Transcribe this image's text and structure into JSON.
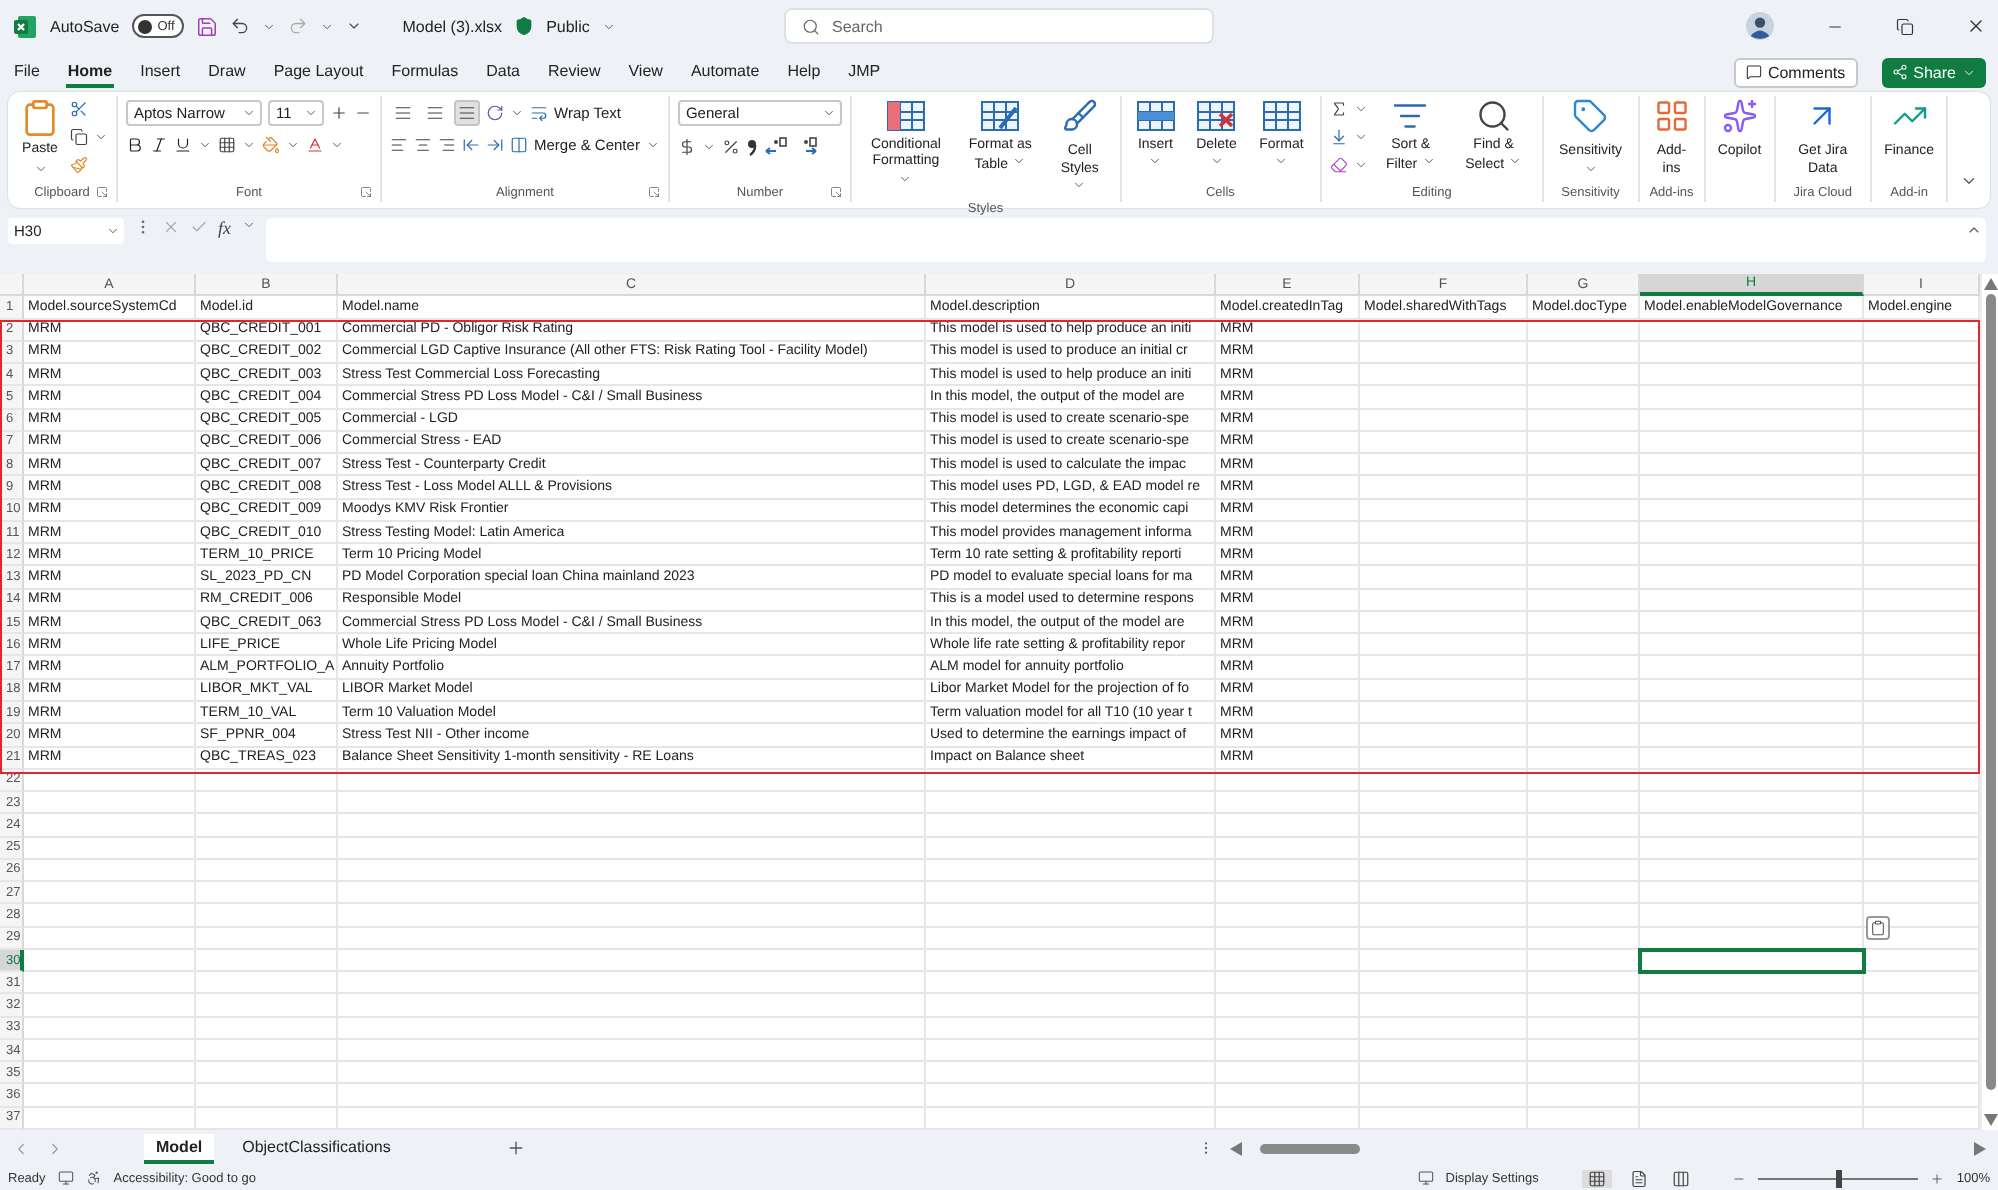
{
  "title_bar": {
    "autosave_label": "AutoSave",
    "autosave": {
      "on": false,
      "label": "Off"
    },
    "file_name": "Model (3).xlsx",
    "sensitivity": "Public",
    "search_placeholder": "Search"
  },
  "menu_tabs": [
    {
      "label": "File",
      "selected": false
    },
    {
      "label": "Home",
      "selected": true
    },
    {
      "label": "Insert",
      "selected": false
    },
    {
      "label": "Draw",
      "selected": false
    },
    {
      "label": "Page Layout",
      "selected": false
    },
    {
      "label": "Formulas",
      "selected": false
    },
    {
      "label": "Data",
      "selected": false
    },
    {
      "label": "Review",
      "selected": false
    },
    {
      "label": "View",
      "selected": false
    },
    {
      "label": "Automate",
      "selected": false
    },
    {
      "label": "Help",
      "selected": false
    },
    {
      "label": "JMP",
      "selected": false
    }
  ],
  "comments": "Comments",
  "share": "Share",
  "ribbon": {
    "groups": [
      {
        "kind": "clipboard",
        "label": "Clipboard",
        "paste": "Paste"
      },
      {
        "kind": "font",
        "label": "Font",
        "font_name": "Aptos Narrow",
        "font_size": "11"
      },
      {
        "kind": "alignment",
        "label": "Alignment",
        "wrap": "Wrap Text",
        "merge": "Merge & Center",
        "vertical_align": [
          {
            "selected": false
          },
          {
            "selected": false
          },
          {
            "selected": true
          }
        ]
      },
      {
        "kind": "number",
        "label": "Number",
        "format": "General"
      },
      {
        "kind": "buttons",
        "label": "Styles",
        "buttons": [
          {
            "label": "Conditional Formatting",
            "dropdown": true
          },
          {
            "label": "Format as Table",
            "dropdown": true
          },
          {
            "label": "Cell Styles",
            "dropdown": true
          }
        ]
      },
      {
        "kind": "buttons",
        "label": "Cells",
        "buttons": [
          {
            "label": "Insert",
            "dropdown": true
          },
          {
            "label": "Delete",
            "dropdown": true
          },
          {
            "label": "Format",
            "dropdown": true
          }
        ]
      },
      {
        "kind": "editing",
        "label": "Editing",
        "buttons": [
          {
            "label": "Sort & Filter",
            "dropdown": true
          },
          {
            "label": "Find & Select",
            "dropdown": true
          }
        ]
      },
      {
        "kind": "buttons",
        "label": "Sensitivity",
        "buttons": [
          {
            "label": "Sensitivity",
            "dropdown": true
          }
        ]
      },
      {
        "kind": "buttons",
        "label": "Add-ins",
        "buttons": [
          {
            "label": "Add-ins",
            "dropdown": false
          }
        ]
      },
      {
        "kind": "buttons",
        "buttons": [
          {
            "label": "Copilot",
            "dropdown": false
          }
        ]
      },
      {
        "kind": "buttons",
        "label": "Jira Cloud",
        "buttons": [
          {
            "label": "Get Jira Data",
            "dropdown": false
          }
        ]
      },
      {
        "kind": "buttons",
        "label": "Add-in",
        "buttons": [
          {
            "label": "Finance",
            "dropdown": false
          }
        ]
      }
    ]
  },
  "formula_bar": {
    "name_box": "H30",
    "function_label": "fx"
  },
  "columns": [
    {
      "letter": "A",
      "selected": false
    },
    {
      "letter": "B",
      "selected": false
    },
    {
      "letter": "C",
      "selected": false
    },
    {
      "letter": "D",
      "selected": false
    },
    {
      "letter": "E",
      "selected": false
    },
    {
      "letter": "F",
      "selected": false
    },
    {
      "letter": "G",
      "selected": false
    },
    {
      "letter": "H",
      "selected": true
    },
    {
      "letter": "I",
      "selected": false
    }
  ],
  "rows": [
    {
      "number": "1",
      "selected": false,
      "outlined": false,
      "cells": [
        "Model.sourceSystemCd",
        "Model.id",
        "Model.name",
        "Model.description",
        "Model.createdInTag",
        "Model.sharedWithTags",
        "Model.docType",
        "Model.enableModelGovernance",
        "Model.engine"
      ]
    },
    {
      "number": "2",
      "selected": false,
      "outlined": true,
      "cells": [
        "MRM",
        "QBC_CREDIT_001",
        "Commercial PD - Obligor Risk Rating",
        "This model is used to help produce an initi",
        "MRM"
      ]
    },
    {
      "number": "3",
      "selected": false,
      "outlined": true,
      "cells": [
        "MRM",
        "QBC_CREDIT_002",
        "Commercial LGD Captive Insurance (All other FTS: Risk Rating Tool - Facility Model)",
        "This model is used to produce an initial cr",
        "MRM"
      ]
    },
    {
      "number": "4",
      "selected": false,
      "outlined": true,
      "cells": [
        "MRM",
        "QBC_CREDIT_003",
        "Stress Test Commercial Loss Forecasting",
        "This model is used to help produce an initi",
        "MRM"
      ]
    },
    {
      "number": "5",
      "selected": false,
      "outlined": true,
      "cells": [
        "MRM",
        "QBC_CREDIT_004",
        "Commercial Stress PD Loss Model  - C&I / Small Business",
        "In this model, the output of the model are",
        "MRM"
      ]
    },
    {
      "number": "6",
      "selected": false,
      "outlined": true,
      "cells": [
        "MRM",
        "QBC_CREDIT_005",
        "Commercial - LGD",
        "This model is used to create scenario-spe",
        "MRM"
      ]
    },
    {
      "number": "7",
      "selected": false,
      "outlined": true,
      "cells": [
        "MRM",
        "QBC_CREDIT_006",
        "Commercial Stress - EAD",
        "This model is used to create scenario-spe",
        "MRM"
      ]
    },
    {
      "number": "8",
      "selected": false,
      "outlined": true,
      "cells": [
        "MRM",
        "QBC_CREDIT_007",
        "Stress Test - Counterparty Credit",
        "This model is used to calculate the impac",
        "MRM"
      ]
    },
    {
      "number": "9",
      "selected": false,
      "outlined": true,
      "cells": [
        "MRM",
        "QBC_CREDIT_008",
        "Stress Test - Loss Model ALLL & Provisions",
        "This model uses PD, LGD, & EAD model re",
        "MRM"
      ]
    },
    {
      "number": "10",
      "selected": false,
      "outlined": true,
      "cells": [
        "MRM",
        "QBC_CREDIT_009",
        "Moodys KMV Risk Frontier",
        "This model determines the economic capi",
        "MRM"
      ]
    },
    {
      "number": "11",
      "selected": false,
      "outlined": true,
      "cells": [
        "MRM",
        "QBC_CREDIT_010",
        "Stress Testing Model: Latin America",
        "This model provides management informa",
        "MRM"
      ]
    },
    {
      "number": "12",
      "selected": false,
      "outlined": true,
      "cells": [
        "MRM",
        "TERM_10_PRICE",
        "Term 10 Pricing Model",
        "Term 10 rate setting & profitability reporti",
        "MRM"
      ]
    },
    {
      "number": "13",
      "selected": false,
      "outlined": true,
      "cells": [
        "MRM",
        "SL_2023_PD_CN",
        "PD Model Corporation special loan China mainland 2023",
        "PD model to evaluate special loans for ma",
        "MRM"
      ]
    },
    {
      "number": "14",
      "selected": false,
      "outlined": true,
      "cells": [
        "MRM",
        "RM_CREDIT_006",
        "Responsible Model",
        "This is a model used to determine respons",
        "MRM"
      ]
    },
    {
      "number": "15",
      "selected": false,
      "outlined": true,
      "cells": [
        "MRM",
        "QBC_CREDIT_063",
        "Commercial Stress PD Loss Model  - C&I / Small Business",
        "In this model, the output of the model are",
        "MRM"
      ]
    },
    {
      "number": "16",
      "selected": false,
      "outlined": true,
      "cells": [
        "MRM",
        "LIFE_PRICE",
        "Whole Life Pricing Model",
        "Whole life rate setting & profitability repor",
        "MRM"
      ]
    },
    {
      "number": "17",
      "selected": false,
      "outlined": true,
      "cells": [
        "MRM",
        "ALM_PORTFOLIO_A",
        "Annuity Portfolio",
        "ALM model for annuity portfolio",
        "MRM"
      ]
    },
    {
      "number": "18",
      "selected": false,
      "outlined": true,
      "cells": [
        "MRM",
        "LIBOR_MKT_VAL",
        "LIBOR Market Model",
        "Libor Market Model for the projection of fo",
        "MRM"
      ]
    },
    {
      "number": "19",
      "selected": false,
      "outlined": true,
      "cells": [
        "MRM",
        "TERM_10_VAL",
        "Term 10 Valuation Model",
        "Term valuation model for all T10 (10 year t",
        "MRM"
      ]
    },
    {
      "number": "20",
      "selected": false,
      "outlined": true,
      "cells": [
        "MRM",
        "SF_PPNR_004",
        "Stress Test NII - Other income",
        "Used to determine the earnings impact of",
        "MRM"
      ]
    },
    {
      "number": "21",
      "selected": false,
      "outlined": true,
      "cells": [
        "MRM",
        "QBC_TREAS_023",
        "Balance Sheet Sensitivity 1-month sensitivity - RE Loans",
        "Impact on Balance sheet",
        "MRM"
      ]
    },
    {
      "number": "22",
      "selected": false,
      "outlined": false
    },
    {
      "number": "23",
      "selected": false,
      "outlined": false
    },
    {
      "number": "24",
      "selected": false,
      "outlined": false
    },
    {
      "number": "25",
      "selected": false,
      "outlined": false
    },
    {
      "number": "26",
      "selected": false,
      "outlined": false
    },
    {
      "number": "27",
      "selected": false,
      "outlined": false
    },
    {
      "number": "28",
      "selected": false,
      "outlined": false
    },
    {
      "number": "29",
      "selected": false,
      "outlined": false
    },
    {
      "number": "30",
      "selected": true,
      "outlined": false
    },
    {
      "number": "31",
      "selected": false,
      "outlined": false
    },
    {
      "number": "32",
      "selected": false,
      "outlined": false
    },
    {
      "number": "33",
      "selected": false,
      "outlined": false
    },
    {
      "number": "34",
      "selected": false,
      "outlined": false
    },
    {
      "number": "35",
      "selected": false,
      "outlined": false
    },
    {
      "number": "36",
      "selected": false,
      "outlined": false
    },
    {
      "number": "37",
      "selected": false,
      "outlined": false
    }
  ],
  "sheet_tabs": [
    {
      "label": "Model",
      "selected": true
    },
    {
      "label": "ObjectClassifications",
      "selected": false
    }
  ],
  "status_bar": {
    "ready": "Ready",
    "accessibility": "Accessibility: Good to go",
    "display_settings": "Display Settings",
    "views": [
      {
        "kind": "normal",
        "selected": true
      },
      {
        "kind": "page-layout",
        "selected": false
      },
      {
        "kind": "page-break",
        "selected": false
      }
    ],
    "zoom_slider": {
      "level": 0.5
    },
    "zoom": "100%"
  }
}
